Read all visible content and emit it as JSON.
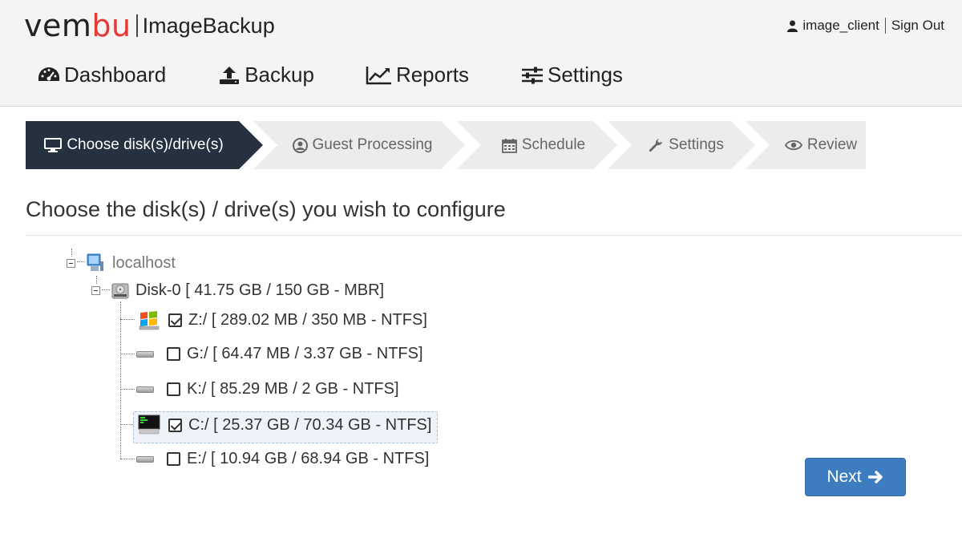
{
  "header": {
    "logo_brand_part1": "vem",
    "logo_brand_part2": "bu",
    "logo_product": "ImageBackup",
    "username": "image_client",
    "signout_label": "Sign Out",
    "accent_color": "#e53935"
  },
  "nav": {
    "items": [
      {
        "label": "Dashboard",
        "icon": "dashboard-icon"
      },
      {
        "label": "Backup",
        "icon": "upload-icon"
      },
      {
        "label": "Reports",
        "icon": "line-chart-icon"
      },
      {
        "label": "Settings",
        "icon": "sliders-icon"
      }
    ]
  },
  "wizard": {
    "steps": [
      {
        "label": "Choose disk(s)/drive(s)",
        "icon": "monitor-icon",
        "active": true
      },
      {
        "label": "Guest Processing",
        "icon": "user-circle-icon",
        "active": false
      },
      {
        "label": "Schedule",
        "icon": "calendar-icon",
        "active": false
      },
      {
        "label": "Settings",
        "icon": "wrench-icon",
        "active": false
      },
      {
        "label": "Review",
        "icon": "eye-icon",
        "active": false
      }
    ],
    "active_color": "#263140",
    "inactive_color": "#ececec"
  },
  "section": {
    "title": "Choose the disk(s) / drive(s) you wish to configure"
  },
  "tree": {
    "host": "localhost",
    "disk": "Disk-0 [ 41.75 GB / 150 GB - MBR]",
    "drives": [
      {
        "label": "Z:/ [ 289.02 MB / 350 MB - NTFS]",
        "checked": true,
        "icon": "windows-drive-icon"
      },
      {
        "label": "G:/ [ 64.47 MB / 3.37 GB - NTFS]",
        "checked": false,
        "icon": "drive-icon"
      },
      {
        "label": "K:/ [ 85.29 MB / 2 GB - NTFS]",
        "checked": false,
        "icon": "drive-icon"
      },
      {
        "label": "C:/ [ 25.37 GB / 70.34 GB - NTFS]",
        "checked": true,
        "icon": "system-drive-icon",
        "selected": true
      },
      {
        "label": "E:/ [ 10.94 GB / 68.94 GB - NTFS]",
        "checked": false,
        "icon": "drive-icon"
      }
    ]
  },
  "actions": {
    "next_label": "Next"
  }
}
